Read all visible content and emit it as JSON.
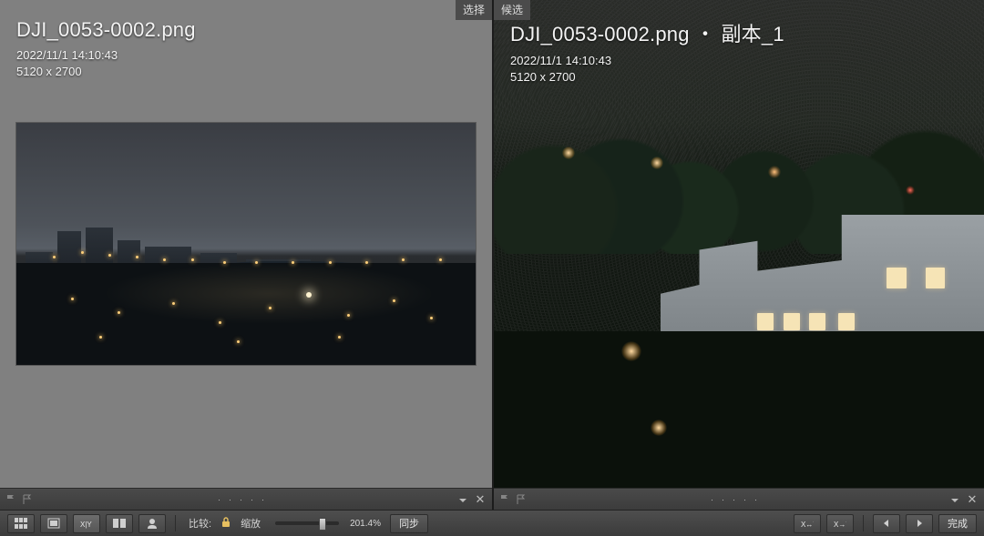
{
  "compare": {
    "left": {
      "tag": "选择",
      "title": "DJI_0053-0002.png",
      "timestamp": "2022/11/1 14:10:43",
      "dimensions": "5120 x 2700"
    },
    "right": {
      "tag": "候选",
      "title": "DJI_0053-0002.png ・ 副本_1",
      "timestamp": "2022/11/1 14:10:43",
      "dimensions": "5120 x 2700"
    }
  },
  "bottom": {
    "compare_label": "比较:",
    "zoom_label": "缩放",
    "zoom_value": "201.4%",
    "sync_label": "同步",
    "done_label": "完成"
  }
}
